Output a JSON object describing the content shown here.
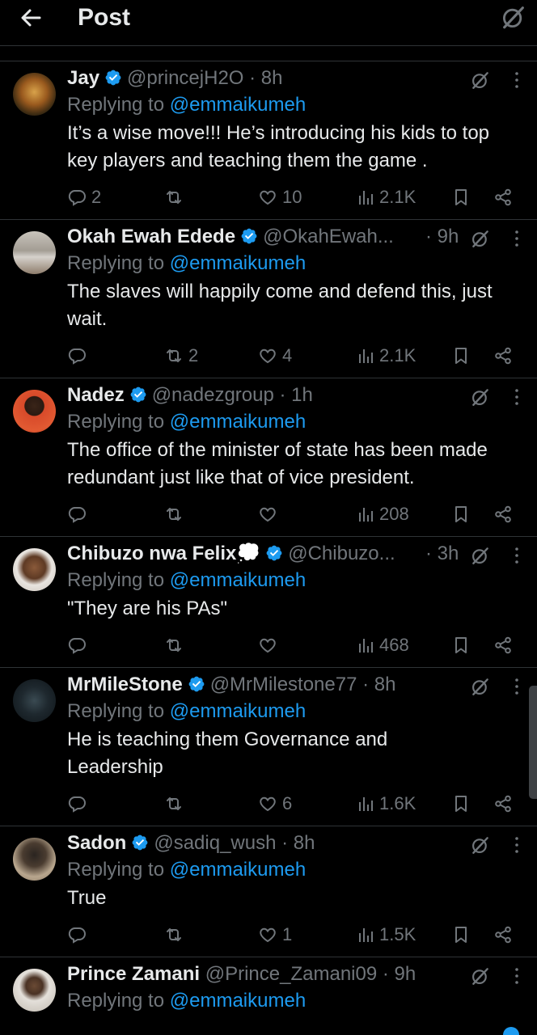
{
  "header": {
    "title": "Post",
    "back_icon": "arrow-left-icon",
    "grok_icon": "grok-icon"
  },
  "colors": {
    "background": "#000000",
    "text": "#e7e9ea",
    "muted": "#71767b",
    "accent": "#1d9bf0",
    "divider": "#2f3336"
  },
  "tweets": [
    {
      "name": "Jay",
      "handle": "@princejH2O",
      "sep": " · ",
      "time": "8h",
      "reply_prefix": "Replying to ",
      "reply_to": "@emmaikumeh",
      "text": "It’s a wise move!!! He’s introducing his kids to top key players and teaching them the game .",
      "replies": "2",
      "reposts": "",
      "likes": "10",
      "views": "2.1K"
    },
    {
      "name": "Okah Ewah Edede",
      "handle": "@OkahEwah...",
      "sep": " · ",
      "time": "9h",
      "reply_prefix": "Replying to ",
      "reply_to": "@emmaikumeh",
      "text": "The slaves will happily come and defend this, just wait.",
      "replies": "",
      "reposts": "2",
      "likes": "4",
      "views": "2.1K"
    },
    {
      "name": "Nadez",
      "handle": "@nadezgroup",
      "sep": " · ",
      "time": "1h",
      "reply_prefix": "Replying to ",
      "reply_to": "@emmaikumeh",
      "text": "The office of the minister of state has been made redundant just like that of vice president.",
      "replies": "",
      "reposts": "",
      "likes": "",
      "views": "208"
    },
    {
      "name": "Chibuzo nwa Felix💭",
      "handle": "@Chibuzo...",
      "sep": " · ",
      "time": "3h",
      "reply_prefix": "Replying to ",
      "reply_to": "@emmaikumeh",
      "text": "\"They are his PAs\"",
      "replies": "",
      "reposts": "",
      "likes": "",
      "views": "468"
    },
    {
      "name": "MrMileStone",
      "handle": "@MrMilestone77",
      "sep": " · ",
      "time": "8h",
      "reply_prefix": "Replying to ",
      "reply_to": "@emmaikumeh",
      "text": "He is teaching them Governance and Leadership",
      "replies": "",
      "reposts": "",
      "likes": "6",
      "views": "1.6K"
    },
    {
      "name": "Sadon",
      "handle": "@sadiq_wush",
      "sep": " · ",
      "time": "8h",
      "reply_prefix": "Replying to ",
      "reply_to": "@emmaikumeh",
      "text": "True",
      "replies": "",
      "reposts": "",
      "likes": "1",
      "views": "1.5K"
    },
    {
      "name": "Prince Zamani",
      "handle": "@Prince_Zamani09",
      "sep": " · ",
      "time": "9h",
      "reply_prefix": "Replying to ",
      "reply_to": "@emmaikumeh",
      "text": "",
      "replies": "",
      "reposts": "",
      "likes": "",
      "views": ""
    }
  ]
}
